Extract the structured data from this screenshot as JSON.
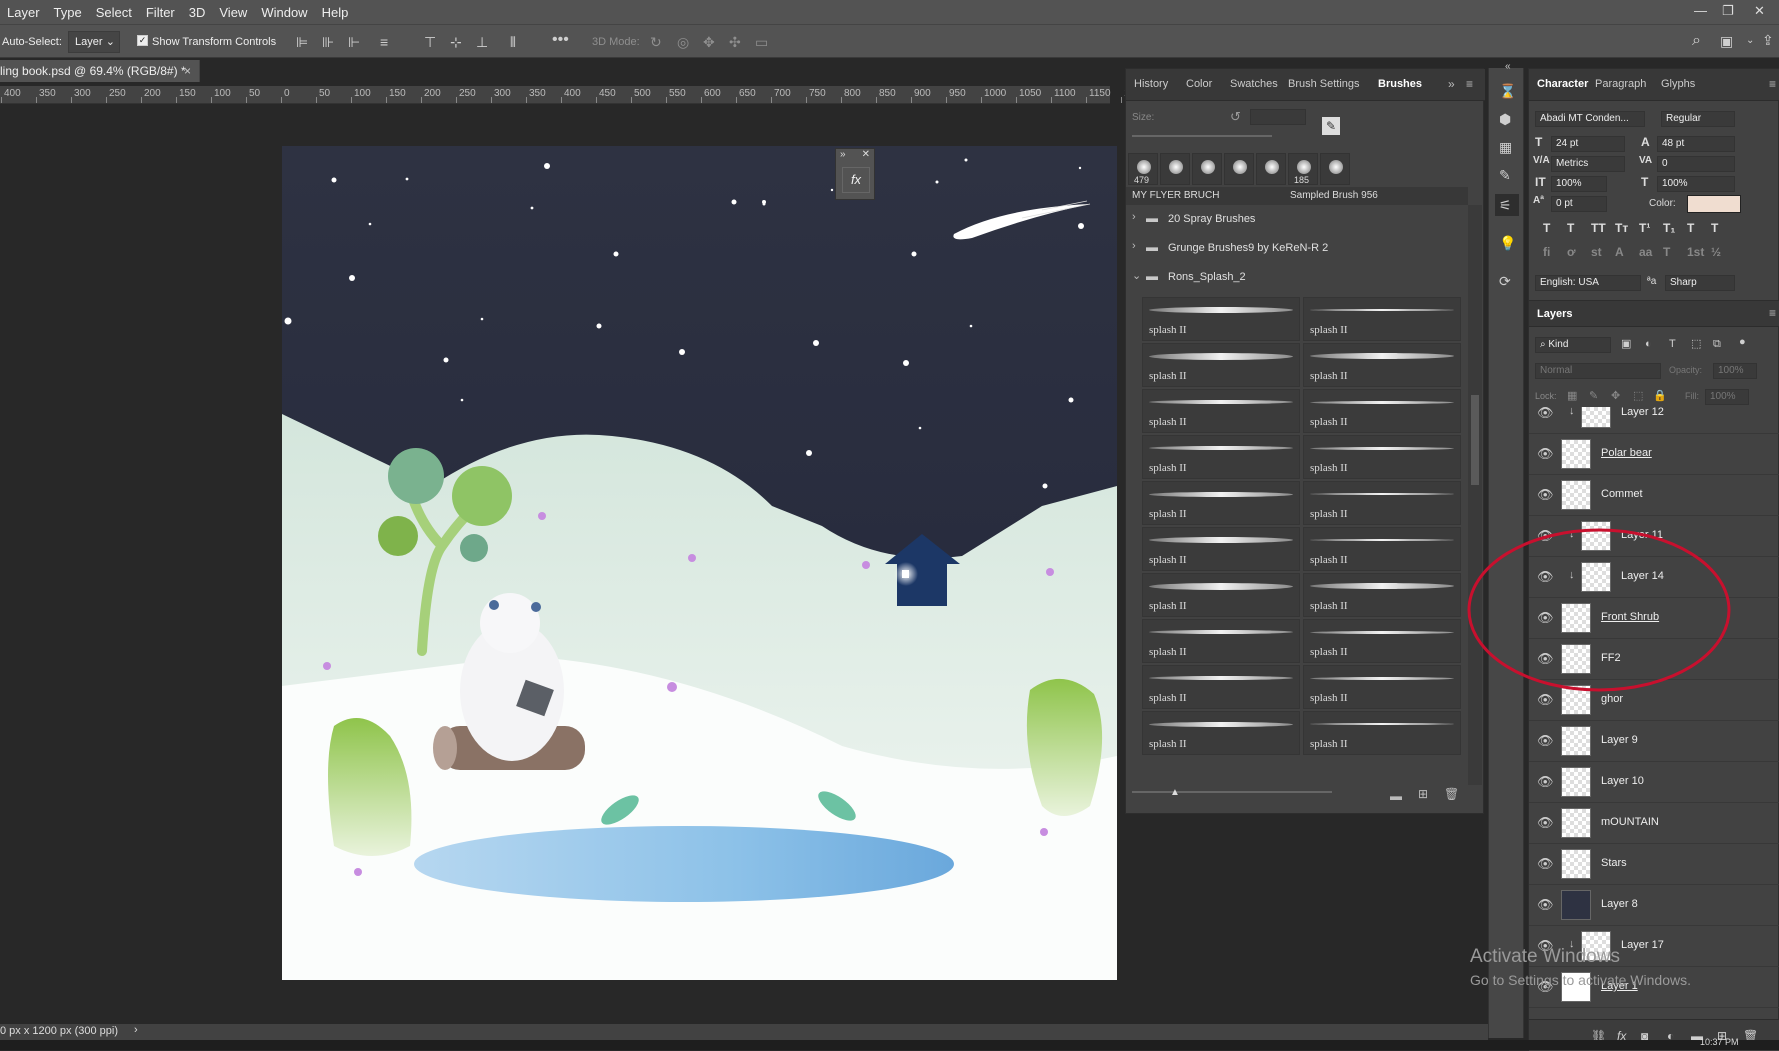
{
  "menu": [
    "Layer",
    "Type",
    "Select",
    "Filter",
    "3D",
    "View",
    "Window",
    "Help"
  ],
  "window_controls": {
    "minimize": "—",
    "restore": "❐",
    "close": "✕"
  },
  "options_bar": {
    "auto_select_label": "Auto-Select:",
    "auto_select_value": "Layer",
    "show_transform_label": "Show Transform Controls",
    "mode_3d_label": "3D Mode:"
  },
  "document_tab": {
    "title": "ling book.psd @ 69.4% (RGB/8#) *",
    "close": "×"
  },
  "ruler_labels": [
    "400",
    "350",
    "300",
    "250",
    "200",
    "150",
    "100",
    "50",
    "0",
    "50",
    "100",
    "150",
    "200",
    "250",
    "300",
    "350",
    "400",
    "450",
    "500",
    "550",
    "600",
    "650",
    "700",
    "750",
    "800",
    "850",
    "900",
    "950",
    "1000",
    "1050",
    "1100",
    "1150",
    "1"
  ],
  "brush_panel": {
    "tabs": [
      "History",
      "Color",
      "Swatches",
      "Brush Settings",
      "Brushes"
    ],
    "active_tab": "Brushes",
    "size_label": "Size:",
    "preset_numbers": [
      "479",
      "185"
    ],
    "current_brush": "MY FLYER BRUCH",
    "sampled_brush": "Sampled Brush 956",
    "groups": [
      {
        "name": "20 Spray Brushes",
        "expanded": false
      },
      {
        "name": "Grunge Brushes9 by KeReN-R 2",
        "expanded": false
      },
      {
        "name": "Rons_Splash_2",
        "expanded": true
      }
    ],
    "brushes": [
      "splash II",
      "splash II",
      "splash II",
      "splash II",
      "splash II",
      "splash II",
      "splash II",
      "splash II",
      "splash II",
      "splash II",
      "splash II",
      "splash II",
      "splash II",
      "splash II",
      "splash II",
      "splash II",
      "splash II",
      "splash II",
      "splash II",
      "splash II"
    ]
  },
  "character_panel": {
    "tabs": [
      "Character",
      "Paragraph",
      "Glyphs"
    ],
    "font_family": "Abadi MT Conden...",
    "font_style": "Regular",
    "font_size": "24 pt",
    "leading": "48 pt",
    "kerning": "Metrics",
    "tracking": "0",
    "vertical_scale": "100%",
    "horizontal_scale": "100%",
    "baseline_shift": "0 pt",
    "color_label": "Color:",
    "text_color": "#f0ddd0",
    "style_buttons": [
      "T",
      "T",
      "TT",
      "Tт",
      "T¹",
      "T₁",
      "T",
      "T"
    ],
    "opentype_buttons": [
      "fi",
      "ơ",
      "st",
      "A",
      "aa",
      "T",
      "1st",
      "½"
    ],
    "language": "English: USA",
    "aa_label": "ªa",
    "antialias": "Sharp"
  },
  "layers_panel": {
    "title": "Layers",
    "filter_kind": "Kind",
    "blend_mode": "Normal",
    "opacity_label": "Opacity:",
    "opacity": "100%",
    "lock_label": "Lock:",
    "fill_label": "Fill:",
    "fill": "100%",
    "layers": [
      {
        "name": "Layer 12",
        "clipped": true
      },
      {
        "name": "Polar bear",
        "clipped": false,
        "underline": true
      },
      {
        "name": "Commet",
        "clipped": false
      },
      {
        "name": "Layer 11",
        "clipped": true
      },
      {
        "name": "Layer 14",
        "clipped": true
      },
      {
        "name": "Front Shrub",
        "clipped": false,
        "underline": true
      },
      {
        "name": "FF2",
        "clipped": false
      },
      {
        "name": "ghor",
        "clipped": false
      },
      {
        "name": "Layer 9",
        "clipped": false
      },
      {
        "name": "Layer 10",
        "clipped": false
      },
      {
        "name": "mOUNTAIN",
        "clipped": false
      },
      {
        "name": "Stars",
        "clipped": false
      },
      {
        "name": "Layer 8",
        "clipped": false,
        "dark": true
      },
      {
        "name": "Layer 17",
        "clipped": true
      },
      {
        "name": "Layer 1",
        "clipped": false,
        "underline": true,
        "white": true
      }
    ]
  },
  "status_bar": {
    "text": "0 px x 1200 px (300 ppi)",
    "arrow": "›"
  },
  "watermark": {
    "line1": "Activate Windows",
    "line2": "Go to Settings to activate Windows."
  },
  "clock": "10:37 PM",
  "annotation_color": "#c8102e"
}
